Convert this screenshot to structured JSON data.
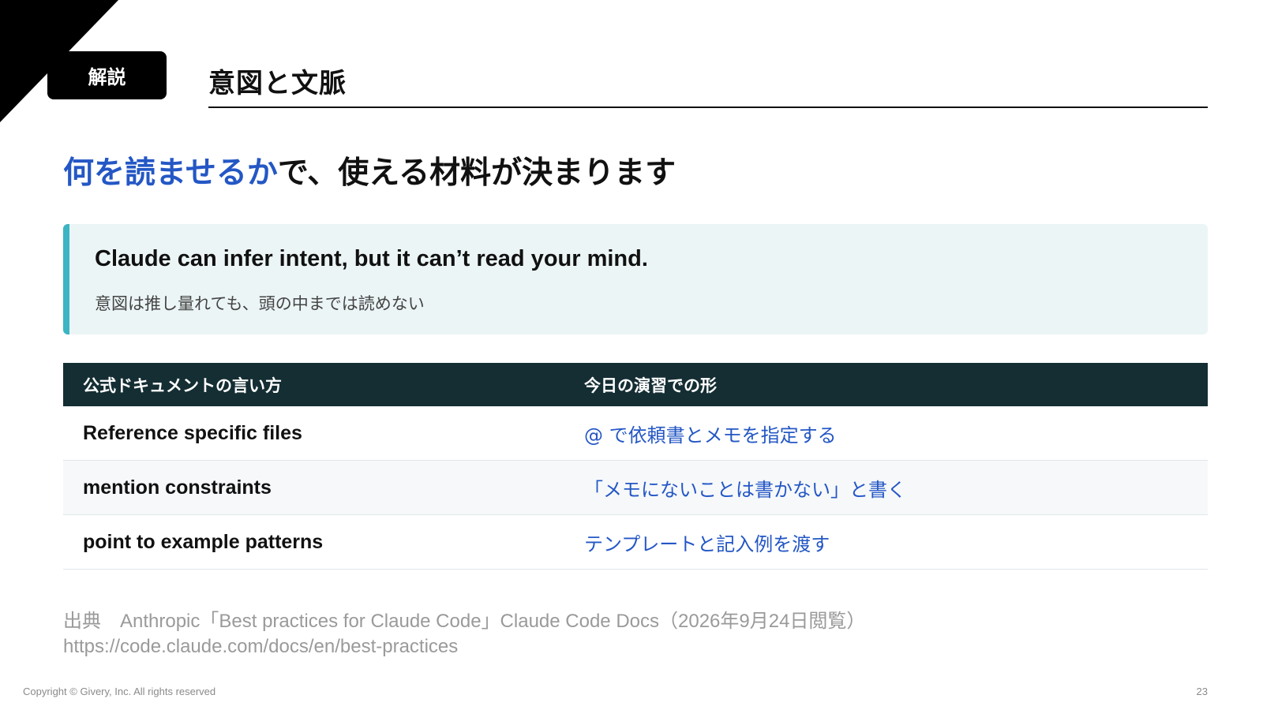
{
  "badge": "解説",
  "header": {
    "title": "意図と文脈"
  },
  "headline": {
    "highlight": "何を読ませるか",
    "rest": "で、使える材料が決まります"
  },
  "quote": {
    "english": "Claude can infer intent, but it can’t read your mind.",
    "japanese": "意図は推し量れても、頭の中までは読めない"
  },
  "table": {
    "headers": [
      "公式ドキュメントの言い方",
      "今日の演習での形"
    ],
    "rows": [
      [
        "Reference specific files",
        "@ で依頼書とメモを指定する"
      ],
      [
        "mention constraints",
        "「メモにないことは書かない」と書く"
      ],
      [
        "point to example patterns",
        "テンプレートと記入例を渡す"
      ]
    ]
  },
  "source": {
    "label": "出典",
    "citation": "Anthropic「Best practices for Claude Code」Claude Code Docs（2026年9月24日閲覧）",
    "url": "https://code.claude.com/docs/en/best-practices"
  },
  "footer": {
    "copyright": "Copyright © Givery, Inc. All rights reserved",
    "page_number": "23"
  },
  "colors": {
    "accent_blue": "#2457c5",
    "quote_bar": "#3bb4c3",
    "table_header": "#142e33"
  }
}
